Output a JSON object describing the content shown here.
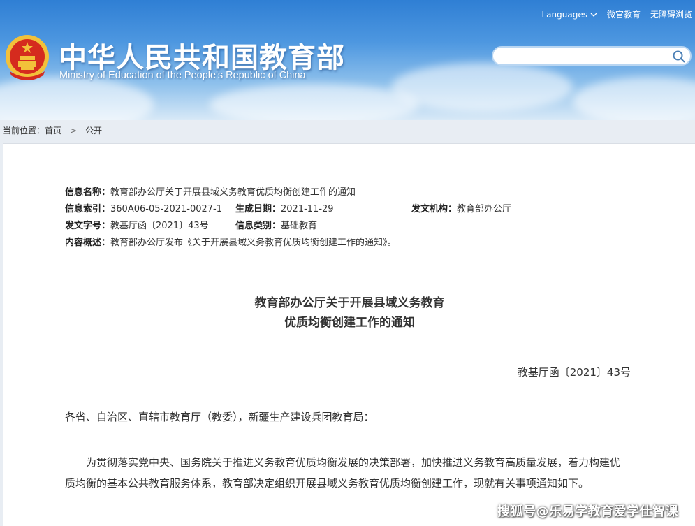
{
  "header": {
    "title_cn": "中华人民共和国教育部",
    "title_en": "Ministry of Education of the People's Republic of China",
    "links": {
      "languages": "Languages",
      "weixin": "微官教育",
      "accessible": "无障碍浏览"
    },
    "search": {
      "placeholder": "",
      "icon": "search-icon"
    }
  },
  "breadcrumb": {
    "prefix": "当前位置：",
    "home": "首页",
    "current": "公开"
  },
  "meta": {
    "name_label": "信息名称：",
    "name_value": "教育部办公厅关于开展县域义务教育优质均衡创建工作的通知",
    "index_label": "信息索引：",
    "index_value": "360A06-05-2021-0027-1",
    "date_label": "生成日期：",
    "date_value": "2021-11-29",
    "org_label": "发文机构：",
    "org_value": "教育部办公厅",
    "docno_label": "发文字号：",
    "docno_value": "教基厅函〔2021〕43号",
    "category_label": "信息类别：",
    "category_value": "基础教育",
    "summary_label": "内容概述：",
    "summary_value": "教育部办公厅发布《关于开展县域义务教育优质均衡创建工作的通知》。"
  },
  "document": {
    "title_line1": "教育部办公厅关于开展县域义务教育",
    "title_line2": "优质均衡创建工作的通知",
    "number": "教基厅函〔2021〕43号",
    "salutation": "各省、自治区、直辖市教育厅（教委），新疆生产建设兵团教育局：",
    "paragraph": "为贯彻落实党中央、国务院关于推进义务教育优质均衡发展的决策部署，加快推进义务教育高质量发展，着力构建优质均衡的基本公共教育服务体系，教育部决定组织开展县域义务教育优质均衡创建工作，现就有关事项通知如下。"
  },
  "watermark": "搜狐号@乐易学教育爱学仕智课",
  "colors": {
    "header_blue": "#2f7fd4",
    "emblem_red": "#d52b1e",
    "emblem_gold": "#f2c13a"
  }
}
